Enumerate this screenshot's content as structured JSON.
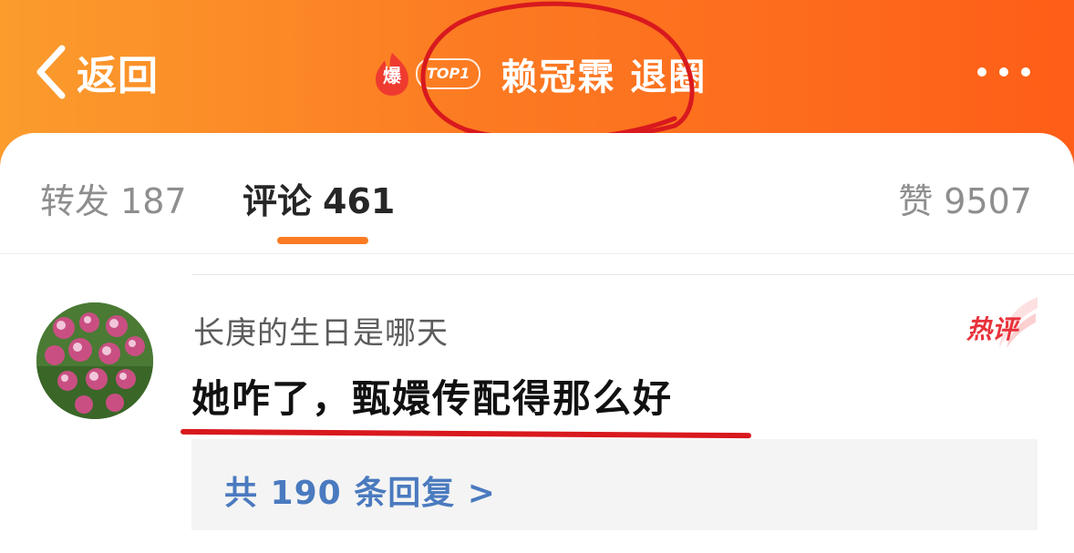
{
  "header": {
    "back_label": "返回",
    "hot_badge": "爆",
    "rank_label": "TOP1",
    "title": "赖冠霖 退圈",
    "more_icon": "more-dots-icon",
    "gradient": [
      "#fb9c2d",
      "#fe5e18"
    ]
  },
  "tabs": [
    {
      "label": "转发",
      "count": "187",
      "active": false
    },
    {
      "label": "评论",
      "count": "461",
      "active": true
    },
    {
      "label": "赞",
      "count": "9507",
      "active": false
    }
  ],
  "comment": {
    "username": "长庚的生日是哪天",
    "hot_tag": "热评",
    "text": "她咋了，甄嬛传配得那么好",
    "replies_label": "共 190 条回复 >"
  },
  "colors": {
    "accent_orange": "#fb7b23",
    "hot_red": "#e8323b",
    "link_blue": "#4a7abf",
    "annotation_red": "#d8191e"
  }
}
